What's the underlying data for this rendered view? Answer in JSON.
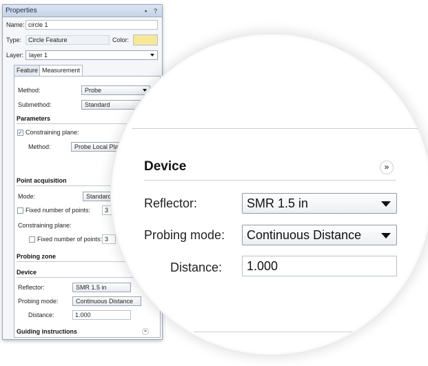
{
  "panel": {
    "title": "Properties",
    "pin_glyph": "▪",
    "help_glyph": "?",
    "name_label": "Name:",
    "name_value": "circle 1",
    "type_label": "Type:",
    "type_value": "Circle Feature",
    "color_label": "Color:",
    "color_value": "#f7e79a",
    "layer_label": "Layer:",
    "layer_value": "layer 1",
    "tabs": [
      {
        "label": "Feature",
        "active": false
      },
      {
        "label": "Measurement",
        "active": true
      }
    ],
    "method_label": "Method:",
    "method_value": "Probe",
    "submethod_label": "Submethod:",
    "submethod_value": "Standard",
    "parameters": {
      "heading": "Parameters",
      "constraining_plane_label": "Constraining plane:",
      "constraining_plane_checked": true,
      "method_label": "Method:",
      "method_value": "Probe Local Plane"
    },
    "point_acquisition": {
      "heading": "Point acquisition",
      "mode_label": "Mode:",
      "mode_value": "Standard",
      "fixed_points_label": "Fixed number of points:",
      "fixed_points_value": "3",
      "constraining_plane_label": "Constraining plane:",
      "fixed_points2_label": "Fixed number of points:",
      "fixed_points2_value": "3"
    },
    "probing_zone": {
      "heading": "Probing zone"
    },
    "device": {
      "heading": "Device",
      "reflector_label": "Reflector:",
      "reflector_value": "SMR 1.5 in",
      "probing_mode_label": "Probing mode:",
      "probing_mode_value": "Continuous Distance",
      "distance_label": "Distance:",
      "distance_value": "1.000"
    },
    "guiding": {
      "heading": "Guiding instructions",
      "collapse_glyph": "»"
    }
  },
  "magnifier": {
    "device_heading": "Device",
    "collapse_glyph": "»",
    "reflector_label": "Reflector:",
    "reflector_value": "SMR 1.5 in",
    "probing_mode_label": "Probing mode:",
    "probing_mode_value": "Continuous Distance",
    "distance_label": "Distance:",
    "distance_value": "1.000"
  }
}
